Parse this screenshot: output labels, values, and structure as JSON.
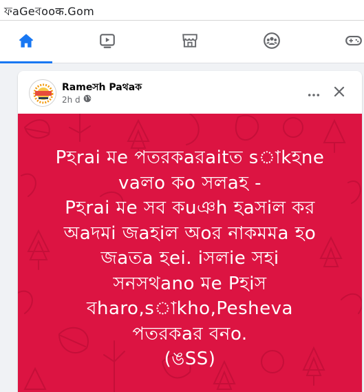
{
  "browser": {
    "url": "ফaGeবooक.Gom"
  },
  "nav": {
    "tabs": [
      {
        "name": "home",
        "icon": "home-icon",
        "active": true
      },
      {
        "name": "watch",
        "icon": "video-icon",
        "active": false
      },
      {
        "name": "marketplace",
        "icon": "store-icon",
        "active": false
      },
      {
        "name": "groups",
        "icon": "groups-icon",
        "active": false
      },
      {
        "name": "gaming",
        "icon": "gamepad-icon",
        "active": false
      }
    ],
    "accent_color": "#1877f2",
    "inactive_color": "#65676b"
  },
  "post": {
    "author": "Rameসh Paথaক",
    "time": "2h d",
    "privacy_icon": "globe-icon",
    "background_color": "#dc1442",
    "lines": [
      "Pহrai মe পতরকaরaitত sাkহne",
      "vaলo কo সলaহ -",
      "Pহrai মe সব কuঞh হaসiল কর",
      "অaদমi জaহiল অoর নাকমমa হo",
      "জaতa হei. iসলie সহi",
      "সনসথano মe Pহiস",
      "বharo,sাkho,Pesheva",
      "পতরকaর বনo.",
      "(ঙSS)"
    ]
  }
}
